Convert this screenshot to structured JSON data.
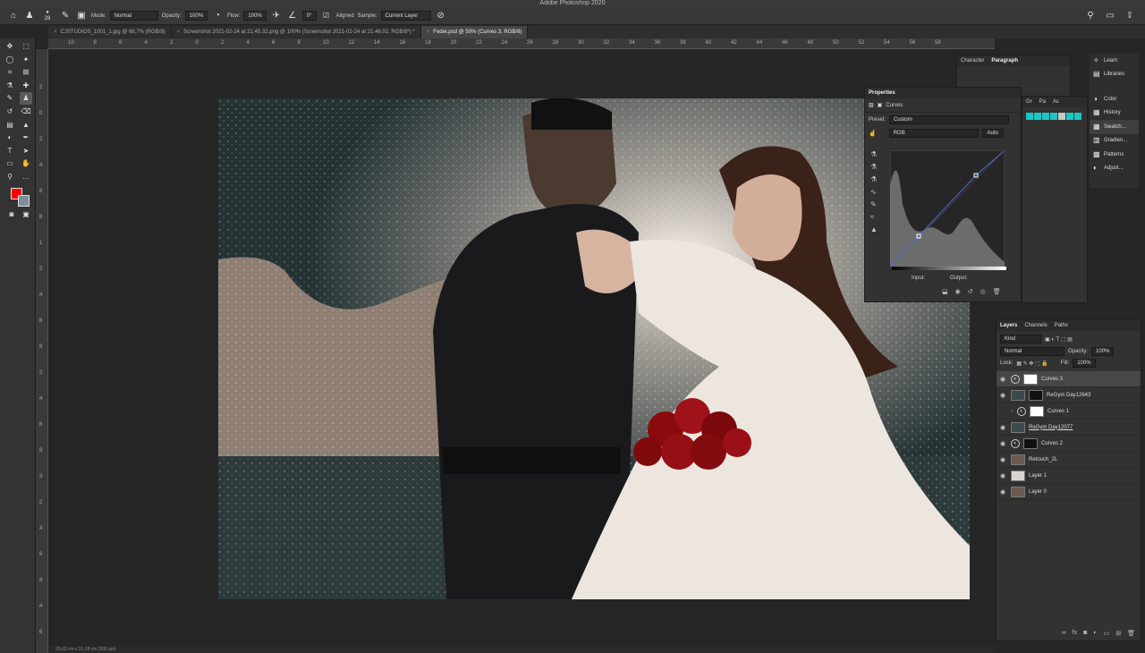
{
  "app": {
    "title": "Adobe Photoshop 2020"
  },
  "options_bar": {
    "brush_size": "28",
    "mode_label": "Mode:",
    "mode_value": "Normal",
    "opacity_label": "Opacity:",
    "opacity_value": "100%",
    "flow_label": "Flow:",
    "flow_value": "100%",
    "angle_value": "0°",
    "aligned_label": "Aligned",
    "sample_label": "Sample:",
    "sample_value": "Current Layer"
  },
  "tabs": [
    {
      "label": "CJSTUDIOS_1001_1.jpg @ 66,7% (RGB/8)"
    },
    {
      "label": "Screenshot 2021-02-24 at 21.45.32.png @ 100% (Screenshot 2021-02-24 at 21.46.02, RGB/8*) *"
    },
    {
      "label": "Feder.psd @ 50% (Curves 3, RGB/8)"
    }
  ],
  "ruler": {
    "top": [
      "10",
      "8",
      "6",
      "4",
      "2",
      "0",
      "2",
      "4",
      "6",
      "8",
      "10",
      "12",
      "14",
      "16",
      "18",
      "20",
      "22",
      "24",
      "26",
      "28",
      "30",
      "32",
      "34",
      "36",
      "38",
      "40",
      "42",
      "44",
      "46",
      "48",
      "50",
      "52",
      "54",
      "56",
      "58"
    ],
    "left": [
      "2",
      "0",
      "2",
      "4",
      "6",
      "8",
      "1",
      "2",
      "4",
      "6",
      "8",
      "2",
      "4",
      "6",
      "8",
      "3",
      "2",
      "4",
      "6",
      "8",
      "4",
      "6"
    ]
  },
  "status": {
    "text": "29,63 cm x 21,18 cm (300 ppi)"
  },
  "properties": {
    "title": "Properties",
    "type_label": "Curves",
    "preset_label": "Preset:",
    "preset_value": "Custom",
    "channel_value": "RGB",
    "auto_label": "Auto",
    "input_label": "Input:",
    "output_label": "Output:"
  },
  "char_panel": {
    "tabs": [
      "Character",
      "Paragraph"
    ]
  },
  "swatches_panel": {
    "tabs": [
      "Gr",
      "Pa",
      "Ac"
    ]
  },
  "side_dock": {
    "items": [
      {
        "label": "Learn",
        "icon": "lightbulb-icon"
      },
      {
        "label": "Libraries",
        "icon": "libraries-icon"
      },
      {
        "label": "Color",
        "icon": "color-icon"
      },
      {
        "label": "History",
        "icon": "history-icon"
      },
      {
        "label": "Swatch...",
        "icon": "swatches-icon"
      },
      {
        "label": "Gradien...",
        "icon": "gradient-icon"
      },
      {
        "label": "Patterns",
        "icon": "patterns-icon"
      },
      {
        "label": "Adjust...",
        "icon": "adjustments-icon"
      }
    ]
  },
  "layers_panel": {
    "tabs": [
      "Layers",
      "Channels",
      "Paths"
    ],
    "filter_value": "Kind",
    "blend_value": "Normal",
    "opacity_label": "Opacity:",
    "opacity_value": "100%",
    "lock_label": "Lock:",
    "fill_label": "Fill:",
    "fill_value": "100%",
    "layers": [
      {
        "name": "Curves 3",
        "kind": "adjustment",
        "visible": true,
        "active": true
      },
      {
        "name": "ReGym Day12643",
        "kind": "pixel-mask",
        "visible": true,
        "active": false
      },
      {
        "name": "Curves 1",
        "kind": "adjustment-clipped",
        "visible": false,
        "active": false
      },
      {
        "name": "ReGym Day12077",
        "kind": "pixel",
        "visible": true,
        "active": false
      },
      {
        "name": "Curves 2",
        "kind": "adjustment-mask",
        "visible": true,
        "active": false
      },
      {
        "name": "Retouch_2L",
        "kind": "pixel",
        "visible": true,
        "active": false
      },
      {
        "name": "Layer 1",
        "kind": "pixel-light",
        "visible": true,
        "active": false
      },
      {
        "name": "Layer 0",
        "kind": "pixel",
        "visible": true,
        "active": false
      }
    ]
  },
  "colors": {
    "foreground": "#ff0000",
    "background": "#7f8f99"
  }
}
